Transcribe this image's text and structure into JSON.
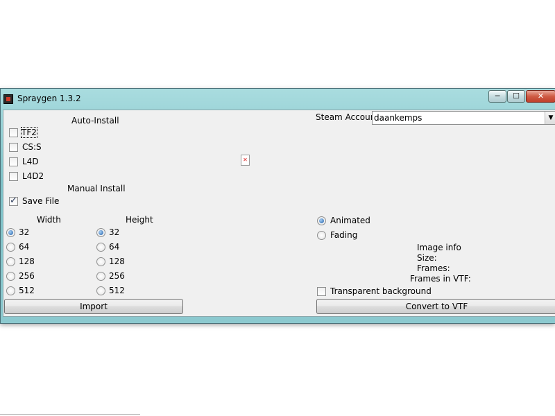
{
  "window": {
    "title": "Spraygen 1.3.2",
    "controls": {
      "minimize": "─",
      "maximize": "☐",
      "close": "✕"
    }
  },
  "auto_install": {
    "heading": "Auto-Install",
    "games": [
      {
        "label": "TF2",
        "checked": false
      },
      {
        "label": "CS:S",
        "checked": false
      },
      {
        "label": "L4D",
        "checked": false
      },
      {
        "label": "L4D2",
        "checked": false
      }
    ]
  },
  "manual_install": {
    "heading": "Manual Install",
    "save_file": {
      "label": "Save File",
      "checked": true
    }
  },
  "width": {
    "heading": "Width",
    "options": [
      "32",
      "64",
      "128",
      "256",
      "512"
    ],
    "selected": "32"
  },
  "height": {
    "heading": "Height",
    "options": [
      "32",
      "64",
      "128",
      "256",
      "512"
    ],
    "selected": "32"
  },
  "steam_account": {
    "label": "Steam Account",
    "value": "daankemps"
  },
  "mode": {
    "options": [
      "Animated",
      "Fading"
    ],
    "selected": "Animated"
  },
  "image_info": {
    "heading": "Image info",
    "size_label": "Size:",
    "frames_label": "Frames:",
    "frames_vtf_label": "Frames in VTF:"
  },
  "transparent_background": {
    "label": "Transparent background",
    "checked": false
  },
  "buttons": {
    "import": "Import",
    "convert": "Convert to VTF"
  },
  "icons": {
    "preview": "broken-image-icon",
    "app": "spraygen-app-icon"
  }
}
